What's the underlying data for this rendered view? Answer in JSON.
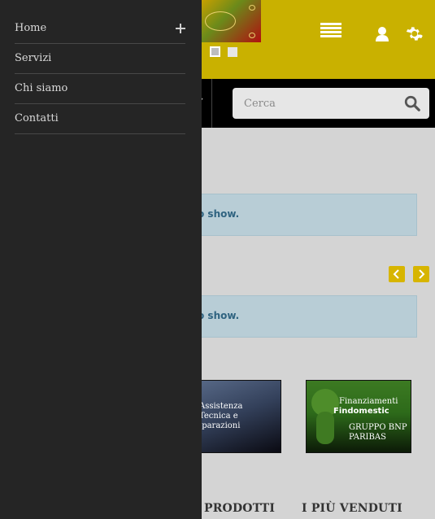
{
  "header": {
    "icons": [
      "hamburger-menu-icon",
      "user-icon",
      "gear-icon"
    ],
    "slider_dots": 2
  },
  "search": {
    "placeholder": "Cerca",
    "icon": "search-icon"
  },
  "content": {
    "alert_1": "o show.",
    "alert_2": "o show.",
    "carousel_prev_icon": "chevron-left-icon",
    "carousel_next_icon": "chevron-right-icon",
    "banners": [
      {
        "text": "Assistenza Tecnica e iparazioni"
      },
      {
        "title": "Finanziamenti",
        "brand": "Findomestic",
        "tagline": "GRUPPO BNP PARIBAS"
      }
    ],
    "section_titles": [
      "PRODOTTI",
      "I PIÙ VENDUTI"
    ]
  },
  "sidebar": {
    "items": [
      {
        "label": "Home",
        "expandable": true
      },
      {
        "label": "Servizi",
        "expandable": false
      },
      {
        "label": "Chi siamo",
        "expandable": false
      },
      {
        "label": "Contatti",
        "expandable": false
      }
    ]
  },
  "colors": {
    "header_bg": "#c9b100",
    "sidebar_bg": "#252525",
    "accent": "#d7b500",
    "alert_bg": "#b8cdd6"
  }
}
